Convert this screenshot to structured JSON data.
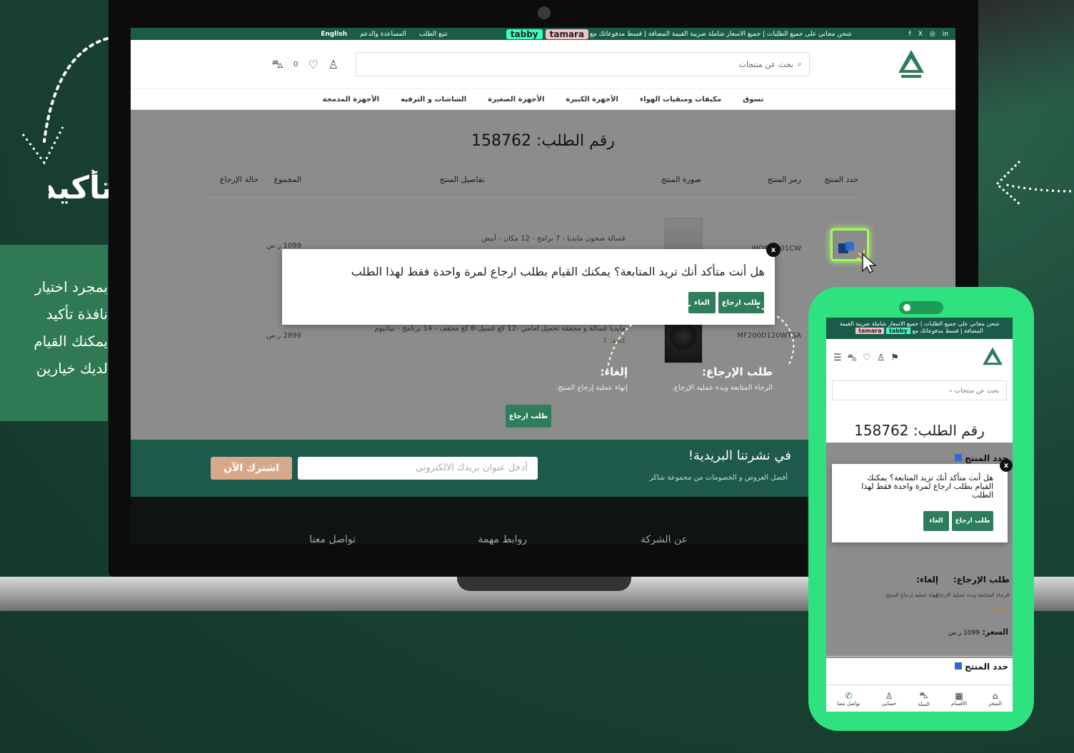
{
  "promo": {
    "title": "تأكيد",
    "lines": [
      "بمجرد اختيار",
      "نافذة تأكيد",
      "يمكنك القيام",
      "لديك خيارين"
    ]
  },
  "site": {
    "topbar": {
      "language": "English",
      "help": "المساعدة والدعم",
      "track": "تتبع الطلب",
      "shipping": "شحن مجاني على جميع الطلبات | جميع الاسعار شاملة ضريبة القيمة المضافة | قسط مدفوعاتك مع",
      "tabby": "tabby",
      "tamara": "tamara",
      "social": [
        "in",
        "◎",
        "X",
        "f"
      ]
    },
    "search_placeholder": "بحث عن منتجات",
    "cart_count": "0",
    "nav": [
      "تسوق",
      "مكيفات ومنقيات الهواء",
      "الأجهزة الكبيرة",
      "الأجهزة الصغيرة",
      "الشاشات و الترفيه",
      "الأجهزة المدمجة"
    ],
    "order_title": "رقم الطلب: 158762",
    "table_headers": [
      "حدد المنتج",
      "رمز المنتج",
      "صورة المنتج",
      "تفاصيل المنتج",
      "المجموع",
      "حالة الإرجاع"
    ],
    "rows": [
      {
        "code": "WOP1…01CW",
        "details": "غسالة صحون مايديا - 7 برامج - 12 مكان - أبيض",
        "qty": "",
        "total": "1099 ر.س"
      },
      {
        "code": "MF200D120WTSA",
        "details": "مايديا غسالة و مجففة تحميل امامي -12 كغ غسيل-8 كغ مجفف - 14 برنامج - تيتانيوم",
        "qty": "كمية: 1",
        "total": "2899 ر.س"
      }
    ],
    "return_button": "طلب ارجاع",
    "modal": {
      "question": "هل أنت متأكد أنك تريد المتابعة؟ يمكنك القيام بطلب ارجاع لمرة واحدة فقط لهذا الطلب",
      "confirm": "طلب ارجاع",
      "cancel": "الغاء",
      "close": "x"
    },
    "newsletter": {
      "title": "في نشرتنا البريدية!",
      "subtitle": "أفضل العروض و الخصومات من مجموعة شاكر",
      "placeholder": "أدخل عنوان بريدك الالكتروني",
      "button": "اشترك الآن"
    },
    "footer": [
      "عن الشركة",
      "روابط مهمة",
      "تواصل معنا"
    ]
  },
  "annotations": {
    "return": {
      "title": "طلب الإرجاع:",
      "desc": "الرجاء المتابعة وبدء عملية الإرجاع."
    },
    "cancel": {
      "title": "إلغاء:",
      "desc": "إنهاء عملية إرجاع المنتج."
    }
  },
  "phone": {
    "topbar": "شحن مجاني على جميع الطلبات | جميع الاسعار شاملة ضريبة القيمة المضافة | قسط مدفوعاتك مع",
    "tabby": "tabby",
    "tamara": "tamara",
    "search_placeholder": "بحث عن منتجات",
    "order_title": "رقم الطلب: 158762",
    "select_label": "حدد المنتج",
    "modal_question": "هل أنت متأكد أنك تريد المتابعة؟ يمكنك القيام بطلب ارجاع لمرة واحدة فقط لهذا الطلب",
    "confirm": "طلب ارجاع",
    "cancel": "الغاء",
    "qty": "كمية: 1",
    "price_label": "السعر:",
    "price_value": "1099 ر.س",
    "bottom_nav": [
      "المتجر",
      "الأقسام",
      "السلة",
      "حسابي",
      "تواصل معنا"
    ]
  },
  "colors": {
    "brand_green": "#1b5b4a",
    "button_green": "#2e7d5b",
    "phone_frame": "#2ee27f",
    "highlight": "#9bff5a"
  }
}
